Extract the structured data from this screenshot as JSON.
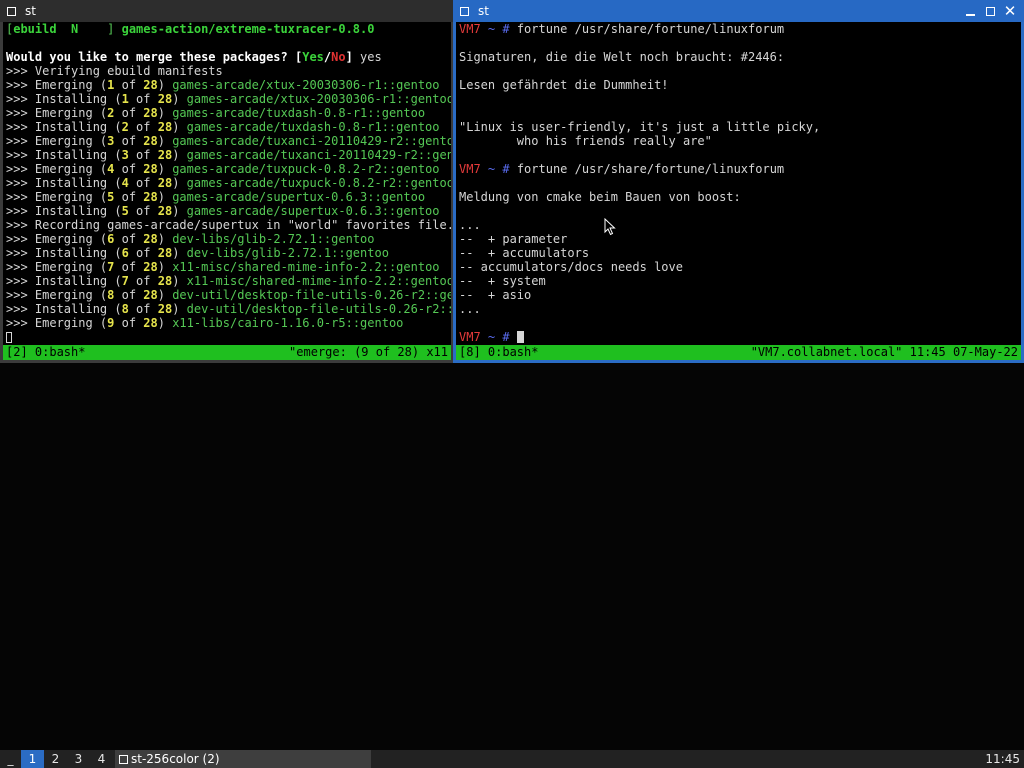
{
  "left_window": {
    "title": "st",
    "lines": [
      [
        {
          "t": "[",
          "c": "c-green"
        },
        {
          "t": "ebuild  N    ",
          "c": "c-bgreen"
        },
        {
          "t": "] ",
          "c": "c-green"
        },
        {
          "t": "games-action/extreme-tuxracer-0.8.0",
          "c": "c-bgreen"
        }
      ],
      [
        {
          "t": "",
          "c": ""
        }
      ],
      [
        {
          "t": "Would you like to merge these packages? ",
          "c": "c-white-b"
        },
        {
          "t": "[",
          "c": "c-white-b"
        },
        {
          "t": "Yes",
          "c": "c-bgreen"
        },
        {
          "t": "/",
          "c": "c-white-b"
        },
        {
          "t": "No",
          "c": "c-bred"
        },
        {
          "t": "]",
          "c": "c-white-b"
        },
        {
          "t": " yes",
          "c": ""
        }
      ],
      [
        {
          "t": ">>> Verifying ebuild manifests",
          "c": ""
        }
      ],
      [
        {
          "t": ">>> Emerging (",
          "c": ""
        },
        {
          "t": "1",
          "c": "c-yellow"
        },
        {
          "t": " of ",
          "c": ""
        },
        {
          "t": "28",
          "c": "c-yellow"
        },
        {
          "t": ") ",
          "c": ""
        },
        {
          "t": "games-arcade/xtux-20030306-r1::gentoo",
          "c": "c-green"
        }
      ],
      [
        {
          "t": ">>> Installing (",
          "c": ""
        },
        {
          "t": "1",
          "c": "c-yellow"
        },
        {
          "t": " of ",
          "c": ""
        },
        {
          "t": "28",
          "c": "c-yellow"
        },
        {
          "t": ") ",
          "c": ""
        },
        {
          "t": "games-arcade/xtux-20030306-r1::gentoo",
          "c": "c-green"
        }
      ],
      [
        {
          "t": ">>> Emerging (",
          "c": ""
        },
        {
          "t": "2",
          "c": "c-yellow"
        },
        {
          "t": " of ",
          "c": ""
        },
        {
          "t": "28",
          "c": "c-yellow"
        },
        {
          "t": ") ",
          "c": ""
        },
        {
          "t": "games-arcade/tuxdash-0.8-r1::gentoo",
          "c": "c-green"
        }
      ],
      [
        {
          "t": ">>> Installing (",
          "c": ""
        },
        {
          "t": "2",
          "c": "c-yellow"
        },
        {
          "t": " of ",
          "c": ""
        },
        {
          "t": "28",
          "c": "c-yellow"
        },
        {
          "t": ") ",
          "c": ""
        },
        {
          "t": "games-arcade/tuxdash-0.8-r1::gentoo",
          "c": "c-green"
        }
      ],
      [
        {
          "t": ">>> Emerging (",
          "c": ""
        },
        {
          "t": "3",
          "c": "c-yellow"
        },
        {
          "t": " of ",
          "c": ""
        },
        {
          "t": "28",
          "c": "c-yellow"
        },
        {
          "t": ") ",
          "c": ""
        },
        {
          "t": "games-arcade/tuxanci-20110429-r2::gentoo",
          "c": "c-green"
        }
      ],
      [
        {
          "t": ">>> Installing (",
          "c": ""
        },
        {
          "t": "3",
          "c": "c-yellow"
        },
        {
          "t": " of ",
          "c": ""
        },
        {
          "t": "28",
          "c": "c-yellow"
        },
        {
          "t": ") ",
          "c": ""
        },
        {
          "t": "games-arcade/tuxanci-20110429-r2::gento",
          "c": "c-green"
        }
      ],
      [
        {
          "t": ">>> Emerging (",
          "c": ""
        },
        {
          "t": "4",
          "c": "c-yellow"
        },
        {
          "t": " of ",
          "c": ""
        },
        {
          "t": "28",
          "c": "c-yellow"
        },
        {
          "t": ") ",
          "c": ""
        },
        {
          "t": "games-arcade/tuxpuck-0.8.2-r2::gentoo",
          "c": "c-green"
        }
      ],
      [
        {
          "t": ">>> Installing (",
          "c": ""
        },
        {
          "t": "4",
          "c": "c-yellow"
        },
        {
          "t": " of ",
          "c": ""
        },
        {
          "t": "28",
          "c": "c-yellow"
        },
        {
          "t": ") ",
          "c": ""
        },
        {
          "t": "games-arcade/tuxpuck-0.8.2-r2::gentoo",
          "c": "c-green"
        }
      ],
      [
        {
          "t": ">>> Emerging (",
          "c": ""
        },
        {
          "t": "5",
          "c": "c-yellow"
        },
        {
          "t": " of ",
          "c": ""
        },
        {
          "t": "28",
          "c": "c-yellow"
        },
        {
          "t": ") ",
          "c": ""
        },
        {
          "t": "games-arcade/supertux-0.6.3::gentoo",
          "c": "c-green"
        }
      ],
      [
        {
          "t": ">>> Installing (",
          "c": ""
        },
        {
          "t": "5",
          "c": "c-yellow"
        },
        {
          "t": " of ",
          "c": ""
        },
        {
          "t": "28",
          "c": "c-yellow"
        },
        {
          "t": ") ",
          "c": ""
        },
        {
          "t": "games-arcade/supertux-0.6.3::gentoo",
          "c": "c-green"
        }
      ],
      [
        {
          "t": ">>> Recording games-arcade/supertux in \"world\" favorites file...",
          "c": ""
        }
      ],
      [
        {
          "t": ">>> Emerging (",
          "c": ""
        },
        {
          "t": "6",
          "c": "c-yellow"
        },
        {
          "t": " of ",
          "c": ""
        },
        {
          "t": "28",
          "c": "c-yellow"
        },
        {
          "t": ") ",
          "c": ""
        },
        {
          "t": "dev-libs/glib-2.72.1::gentoo",
          "c": "c-green"
        }
      ],
      [
        {
          "t": ">>> Installing (",
          "c": ""
        },
        {
          "t": "6",
          "c": "c-yellow"
        },
        {
          "t": " of ",
          "c": ""
        },
        {
          "t": "28",
          "c": "c-yellow"
        },
        {
          "t": ") ",
          "c": ""
        },
        {
          "t": "dev-libs/glib-2.72.1::gentoo",
          "c": "c-green"
        }
      ],
      [
        {
          "t": ">>> Emerging (",
          "c": ""
        },
        {
          "t": "7",
          "c": "c-yellow"
        },
        {
          "t": " of ",
          "c": ""
        },
        {
          "t": "28",
          "c": "c-yellow"
        },
        {
          "t": ") ",
          "c": ""
        },
        {
          "t": "x11-misc/shared-mime-info-2.2::gentoo",
          "c": "c-green"
        }
      ],
      [
        {
          "t": ">>> Installing (",
          "c": ""
        },
        {
          "t": "7",
          "c": "c-yellow"
        },
        {
          "t": " of ",
          "c": ""
        },
        {
          "t": "28",
          "c": "c-yellow"
        },
        {
          "t": ") ",
          "c": ""
        },
        {
          "t": "x11-misc/shared-mime-info-2.2::gentoo",
          "c": "c-green"
        }
      ],
      [
        {
          "t": ">>> Emerging (",
          "c": ""
        },
        {
          "t": "8",
          "c": "c-yellow"
        },
        {
          "t": " of ",
          "c": ""
        },
        {
          "t": "28",
          "c": "c-yellow"
        },
        {
          "t": ") ",
          "c": ""
        },
        {
          "t": "dev-util/desktop-file-utils-0.26-r2::gent",
          "c": "c-green"
        }
      ],
      [
        {
          "t": ">>> Installing (",
          "c": ""
        },
        {
          "t": "8",
          "c": "c-yellow"
        },
        {
          "t": " of ",
          "c": ""
        },
        {
          "t": "28",
          "c": "c-yellow"
        },
        {
          "t": ") ",
          "c": ""
        },
        {
          "t": "dev-util/desktop-file-utils-0.26-r2::ge",
          "c": "c-green"
        }
      ],
      [
        {
          "t": ">>> Emerging (",
          "c": ""
        },
        {
          "t": "9",
          "c": "c-yellow"
        },
        {
          "t": " of ",
          "c": ""
        },
        {
          "t": "28",
          "c": "c-yellow"
        },
        {
          "t": ") ",
          "c": ""
        },
        {
          "t": "x11-libs/cairo-1.16.0-r5::gentoo",
          "c": "c-green"
        }
      ]
    ],
    "status_left": "[2] 0:bash*",
    "status_right": "\"emerge: (9 of 28) x11"
  },
  "right_window": {
    "title": "st",
    "lines": [
      [
        {
          "t": "VM7",
          "c": "c-red"
        },
        {
          "t": " ~ ",
          "c": "c-blue"
        },
        {
          "t": "# ",
          "c": "c-blue"
        },
        {
          "t": "fortune /usr/share/fortune/linuxforum",
          "c": ""
        }
      ],
      [
        {
          "t": "",
          "c": ""
        }
      ],
      [
        {
          "t": "Signaturen, die die Welt noch braucht: #2446:",
          "c": ""
        }
      ],
      [
        {
          "t": "",
          "c": ""
        }
      ],
      [
        {
          "t": "Lesen gefährdet die Dummheit!",
          "c": ""
        }
      ],
      [
        {
          "t": "",
          "c": ""
        }
      ],
      [
        {
          "t": "",
          "c": ""
        }
      ],
      [
        {
          "t": "\"Linux is user-friendly, it's just a little picky,",
          "c": ""
        }
      ],
      [
        {
          "t": "        who his friends really are\"",
          "c": ""
        }
      ],
      [
        {
          "t": "",
          "c": ""
        }
      ],
      [
        {
          "t": "VM7",
          "c": "c-red"
        },
        {
          "t": " ~ ",
          "c": "c-blue"
        },
        {
          "t": "# ",
          "c": "c-blue"
        },
        {
          "t": "fortune /usr/share/fortune/linuxforum",
          "c": ""
        }
      ],
      [
        {
          "t": "",
          "c": ""
        }
      ],
      [
        {
          "t": "Meldung von cmake beim Bauen von boost:",
          "c": ""
        }
      ],
      [
        {
          "t": "",
          "c": ""
        }
      ],
      [
        {
          "t": "...",
          "c": ""
        }
      ],
      [
        {
          "t": "--  + parameter",
          "c": ""
        }
      ],
      [
        {
          "t": "--  + accumulators",
          "c": ""
        }
      ],
      [
        {
          "t": "-- accumulators/docs needs love",
          "c": ""
        }
      ],
      [
        {
          "t": "--  + system",
          "c": ""
        }
      ],
      [
        {
          "t": "--  + asio",
          "c": ""
        }
      ],
      [
        {
          "t": "...",
          "c": ""
        }
      ],
      [
        {
          "t": "",
          "c": ""
        }
      ],
      [
        {
          "t": "VM7",
          "c": "c-red"
        },
        {
          "t": " ~ ",
          "c": "c-blue"
        },
        {
          "t": "# ",
          "c": "c-blue"
        }
      ]
    ],
    "status_left": "[8] 0:bash*",
    "status_right": "\"VM7.collabnet.local\" 11:45 07-May-22"
  },
  "taskbar": {
    "underscore": "_",
    "workspaces": [
      "1",
      "2",
      "3",
      "4"
    ],
    "active_workspace": "1",
    "task_label": "st-256color (2)",
    "clock": "11:45"
  }
}
